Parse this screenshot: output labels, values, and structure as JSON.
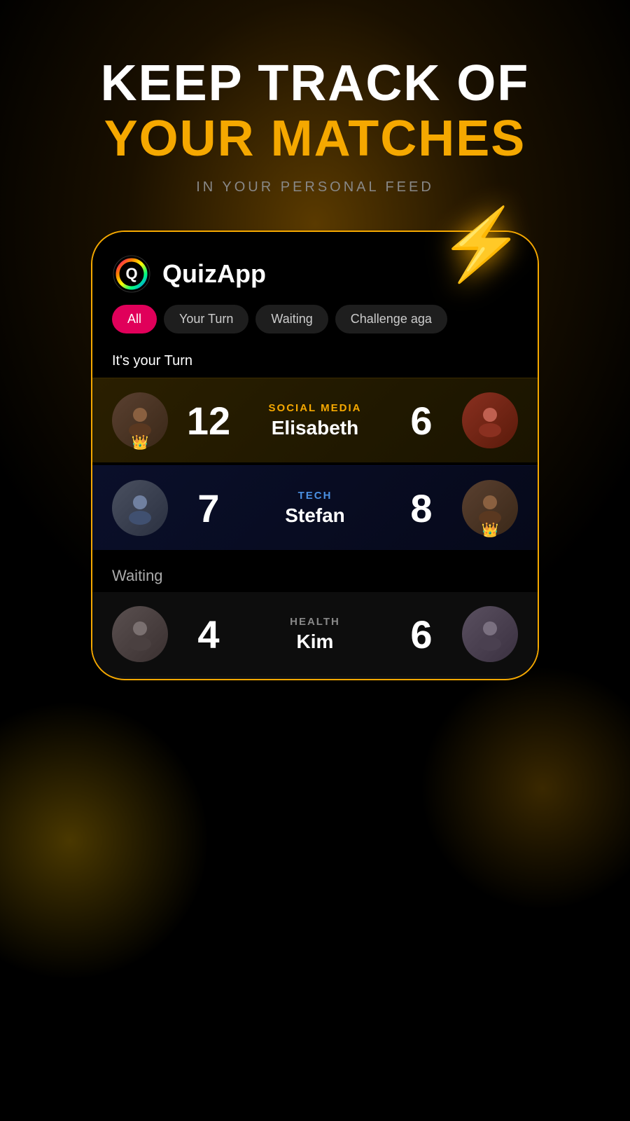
{
  "header": {
    "line1": "KEEP TRACK OF",
    "line2": "YOUR MATCHES",
    "sub": "IN YOUR PERSONAL FEED"
  },
  "app": {
    "name": "QuizApp"
  },
  "tabs": [
    {
      "label": "All",
      "active": true
    },
    {
      "label": "Your Turn",
      "active": false
    },
    {
      "label": "Waiting",
      "active": false
    },
    {
      "label": "Challenge aga",
      "active": false
    }
  ],
  "section_your_turn": "It's your Turn",
  "section_waiting": "Waiting",
  "matches_your_turn": [
    {
      "category": "SOCIAL MEDIA",
      "opponent": "Elisabeth",
      "score_left": "12",
      "score_right": "6",
      "left_has_crown": true,
      "right_has_crown": false,
      "theme": "gold",
      "left_avatar": "man1",
      "right_avatar": "woman1"
    },
    {
      "category": "TECH",
      "opponent": "Stefan",
      "score_left": "7",
      "score_right": "8",
      "left_has_crown": false,
      "right_has_crown": true,
      "theme": "blue",
      "left_avatar": "man2",
      "right_avatar": "man1"
    }
  ],
  "matches_waiting": [
    {
      "category": "HEALTH",
      "opponent": "Kim",
      "score_left": "4",
      "score_right": "6",
      "left_has_crown": false,
      "right_has_crown": false,
      "theme": "gray",
      "left_avatar": "man3",
      "right_avatar": "gray1"
    }
  ],
  "icons": {
    "lightning": "⚡",
    "crown": "👑"
  }
}
